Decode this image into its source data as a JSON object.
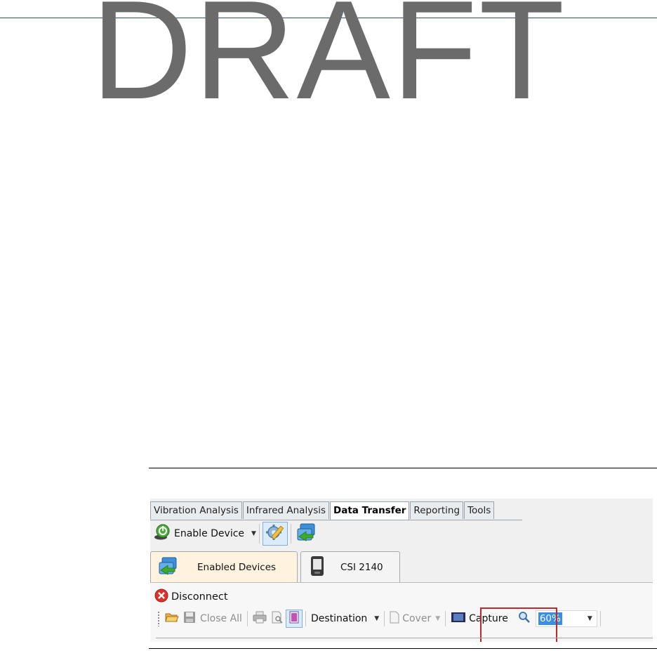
{
  "watermark": "DRAFT",
  "ribbon": {
    "tabs": [
      {
        "label": "Vibration Analysis",
        "active": false
      },
      {
        "label": "Infrared Analysis",
        "active": false
      },
      {
        "label": "Data Transfer",
        "active": true
      },
      {
        "label": "Reporting",
        "active": false
      },
      {
        "label": "Tools",
        "active": false
      }
    ],
    "enable_device_label": "Enable Device",
    "icons": [
      "device-power-icon",
      "settings-wrench-icon",
      "transfer-arrows-icon"
    ]
  },
  "document_tabs": [
    {
      "label": "Enabled Devices",
      "icon": "transfer-arrows-icon"
    },
    {
      "label": "CSI 2140",
      "icon": "handheld-device-icon"
    }
  ],
  "panel": {
    "disconnect_label": "Disconnect",
    "toolbar": {
      "close_all_label": "Close All",
      "destination_label": "Destination",
      "cover_label": "Cover",
      "capture_label": "Capture",
      "zoom_value": "60%"
    }
  },
  "colors": {
    "highlight_box": "#c0282e",
    "selection_blue": "#3b8ee0",
    "watermark_gray": "#6b6b6b"
  }
}
